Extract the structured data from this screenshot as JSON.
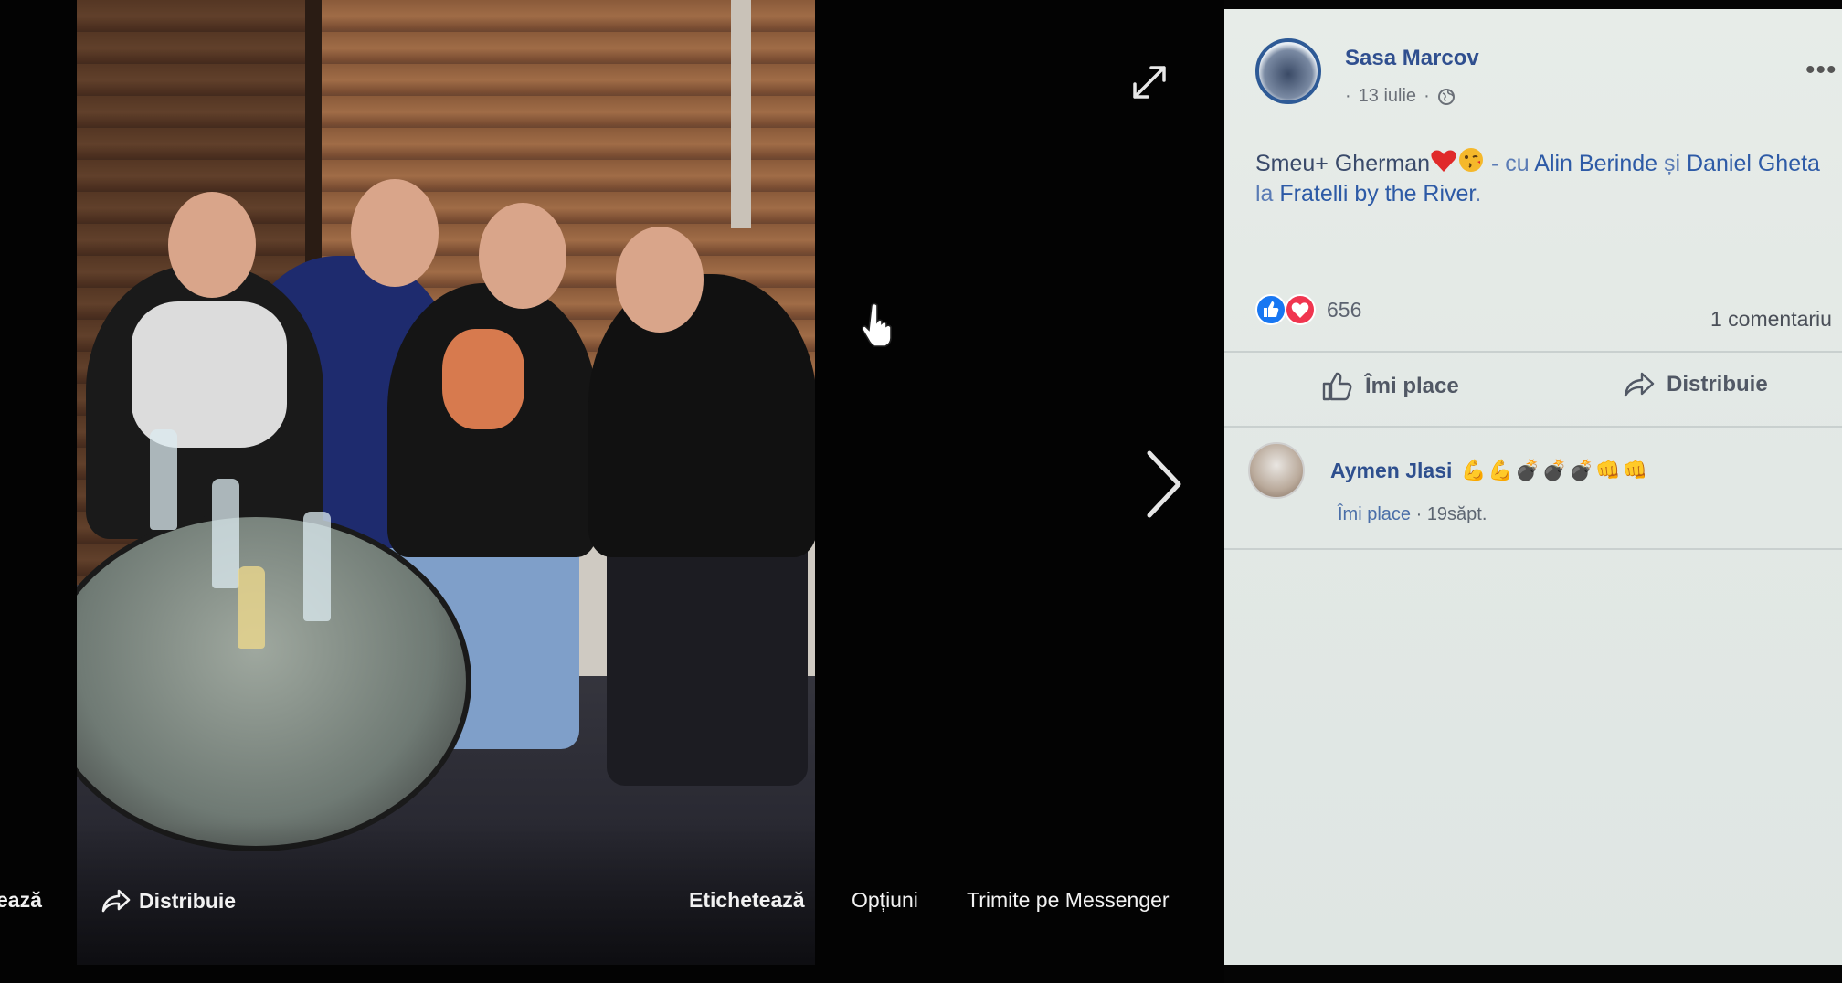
{
  "viewer": {
    "bottom_bar": {
      "tag_cut_label": "ează",
      "share_label": "Distribuie",
      "tag_label": "Etichetează",
      "options_label": "Opțiuni",
      "messenger_label": "Trimite pe Messenger"
    }
  },
  "post": {
    "author": "Sasa Marcov",
    "date": "13 iulie",
    "text_start": "Smeu+ Gherman",
    "text_with": " - cu ",
    "tag1": "Alin Berinde",
    "text_and": " și ",
    "tag2": "Daniel Gheta",
    "text_at": " la ",
    "place": "Fratelli by the River",
    "text_end": ".",
    "reaction_count": "656",
    "comment_count": "1 comentariu",
    "like_label": "Îmi place",
    "share_label": "Distribuie"
  },
  "comment": {
    "author": "Aymen Jlasi",
    "emoji": "💪💪💣💣💣👊👊",
    "like_label": "Îmi place",
    "time": "19săpt."
  },
  "colors": {
    "link": "#2d5aa6",
    "like_blue": "#1877f2",
    "love_red": "#f0354f"
  }
}
